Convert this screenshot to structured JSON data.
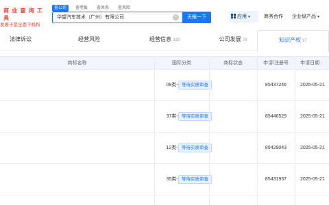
{
  "header": {
    "logo_line1": "商 业 查 询 工 具",
    "logo_line2": "发展子是全面下机构",
    "search_tabs": [
      "查公司",
      "查老板",
      "查关系",
      "查风险"
    ],
    "search_value": "华望汽车技术（广州）有限公司",
    "clear_glyph": "×",
    "search_button": "天眼一下",
    "apps_label": "应用",
    "apps_caret": "▾",
    "biz_coop": "商务合作",
    "enterprise_products": "企业级产品",
    "enterprise_caret": "▾"
  },
  "tabs": [
    {
      "label": "法律诉讼",
      "count": ""
    },
    {
      "label": "经营风险",
      "count": ""
    },
    {
      "label": "经营信息",
      "count": "328"
    },
    {
      "label": "公司发展",
      "count": "78"
    },
    {
      "label": "知识产权",
      "count": "97",
      "active": true
    }
  ],
  "table": {
    "columns": [
      "商标名称",
      "国际分类",
      "商标状态",
      "申请/注册号",
      "申请日期"
    ],
    "sort_glyph": "↕",
    "rows": [
      {
        "category": "09类-科学仪器",
        "status": "等待实质审查",
        "reg_no": "85437246",
        "date": "2025-05-21"
      },
      {
        "category": "37类-建筑修理",
        "status": "等待实质审查",
        "reg_no": "85446529",
        "date": "2025-05-21"
      },
      {
        "category": "12类-运输工具",
        "status": "等待实质审查",
        "reg_no": "85429043",
        "date": "2025-05-21"
      },
      {
        "category": "35类-广告销售",
        "status": "等待实质审查",
        "reg_no": "85431937",
        "date": "2025-05-21"
      }
    ]
  }
}
